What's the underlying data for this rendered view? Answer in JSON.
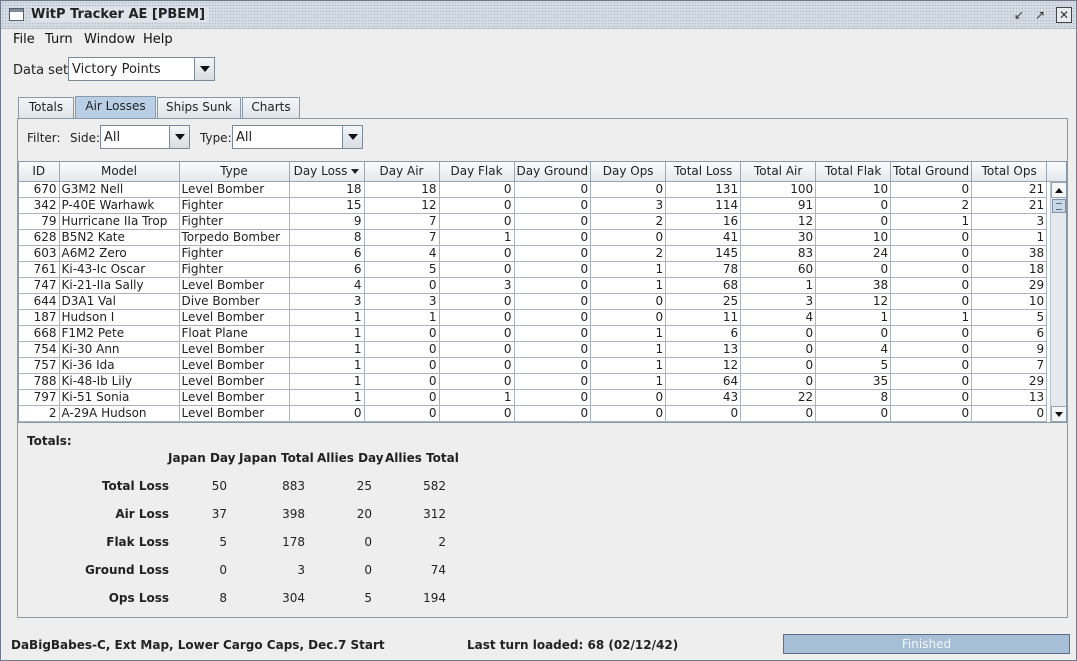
{
  "window": {
    "title": "WitP Tracker AE [PBEM]",
    "controls": [
      "minimize-icon",
      "maximize-icon",
      "close-icon"
    ]
  },
  "menu": [
    "File",
    "Turn",
    "Window",
    "Help"
  ],
  "dataset": {
    "label": "Data set:",
    "value": "Victory Points"
  },
  "tabs": [
    {
      "label": "Totals",
      "active": false
    },
    {
      "label": "Air Losses",
      "active": true
    },
    {
      "label": "Ships Sunk",
      "active": false
    },
    {
      "label": "Charts",
      "active": false
    }
  ],
  "filter": {
    "label": "Filter:",
    "side_label": "Side:",
    "side_value": "All",
    "type_label": "Type:",
    "type_value": "All"
  },
  "table": {
    "columns": [
      "ID",
      "Model",
      "Type",
      "Day Loss",
      "Day Air",
      "Day Flak",
      "Day Ground",
      "Day Ops",
      "Total Loss",
      "Total Air",
      "Total Flak",
      "Total Ground",
      "Total Ops"
    ],
    "sorted_column": "Day Loss",
    "rows": [
      [
        "670",
        "G3M2 Nell",
        "Level Bomber",
        "18",
        "18",
        "0",
        "0",
        "0",
        "131",
        "100",
        "10",
        "0",
        "21"
      ],
      [
        "342",
        "P-40E Warhawk",
        "Fighter",
        "15",
        "12",
        "0",
        "0",
        "3",
        "114",
        "91",
        "0",
        "2",
        "21"
      ],
      [
        "79",
        "Hurricane IIa Trop",
        "Fighter",
        "9",
        "7",
        "0",
        "0",
        "2",
        "16",
        "12",
        "0",
        "1",
        "3"
      ],
      [
        "628",
        "B5N2 Kate",
        "Torpedo Bomber",
        "8",
        "7",
        "1",
        "0",
        "0",
        "41",
        "30",
        "10",
        "0",
        "1"
      ],
      [
        "603",
        "A6M2 Zero",
        "Fighter",
        "6",
        "4",
        "0",
        "0",
        "2",
        "145",
        "83",
        "24",
        "0",
        "38"
      ],
      [
        "761",
        "Ki-43-Ic Oscar",
        "Fighter",
        "6",
        "5",
        "0",
        "0",
        "1",
        "78",
        "60",
        "0",
        "0",
        "18"
      ],
      [
        "747",
        "Ki-21-IIa Sally",
        "Level Bomber",
        "4",
        "0",
        "3",
        "0",
        "1",
        "68",
        "1",
        "38",
        "0",
        "29"
      ],
      [
        "644",
        "D3A1 Val",
        "Dive Bomber",
        "3",
        "3",
        "0",
        "0",
        "0",
        "25",
        "3",
        "12",
        "0",
        "10"
      ],
      [
        "187",
        "Hudson I",
        "Level Bomber",
        "1",
        "1",
        "0",
        "0",
        "0",
        "11",
        "4",
        "1",
        "1",
        "5"
      ],
      [
        "668",
        "F1M2 Pete",
        "Float Plane",
        "1",
        "0",
        "0",
        "0",
        "1",
        "6",
        "0",
        "0",
        "0",
        "6"
      ],
      [
        "754",
        "Ki-30 Ann",
        "Level Bomber",
        "1",
        "0",
        "0",
        "0",
        "1",
        "13",
        "0",
        "4",
        "0",
        "9"
      ],
      [
        "757",
        "Ki-36 Ida",
        "Level Bomber",
        "1",
        "0",
        "0",
        "0",
        "1",
        "12",
        "0",
        "5",
        "0",
        "7"
      ],
      [
        "788",
        "Ki-48-Ib Lily",
        "Level Bomber",
        "1",
        "0",
        "0",
        "0",
        "1",
        "64",
        "0",
        "35",
        "0",
        "29"
      ],
      [
        "797",
        "Ki-51 Sonia",
        "Level Bomber",
        "1",
        "0",
        "1",
        "0",
        "0",
        "43",
        "22",
        "8",
        "0",
        "13"
      ],
      [
        "2",
        "A-29A Hudson",
        "Level Bomber",
        "0",
        "0",
        "0",
        "0",
        "0",
        "0",
        "0",
        "0",
        "0",
        "0"
      ]
    ]
  },
  "totals": {
    "label": "Totals:",
    "headers": [
      "Japan Day",
      "Japan Total",
      "Allies Day",
      "Allies Total"
    ],
    "rows": [
      {
        "label": "Total Loss",
        "values": [
          "50",
          "883",
          "25",
          "582"
        ]
      },
      {
        "label": "Air Loss",
        "values": [
          "37",
          "398",
          "20",
          "312"
        ]
      },
      {
        "label": "Flak Loss",
        "values": [
          "5",
          "178",
          "0",
          "2"
        ]
      },
      {
        "label": "Ground Loss",
        "values": [
          "0",
          "3",
          "0",
          "74"
        ]
      },
      {
        "label": "Ops Loss",
        "values": [
          "8",
          "304",
          "5",
          "194"
        ]
      }
    ]
  },
  "status": {
    "scenario": "DaBigBabes-C, Ext Map, Lower Cargo Caps, Dec.7 Start",
    "last_turn": "Last turn loaded: 68 (02/12/42)",
    "progress_text": "Finished",
    "progress": 1.0
  },
  "colors": {
    "accent": "#b8cfe5",
    "progress": "#a6bed6",
    "title_bg": "#dde3ea"
  }
}
